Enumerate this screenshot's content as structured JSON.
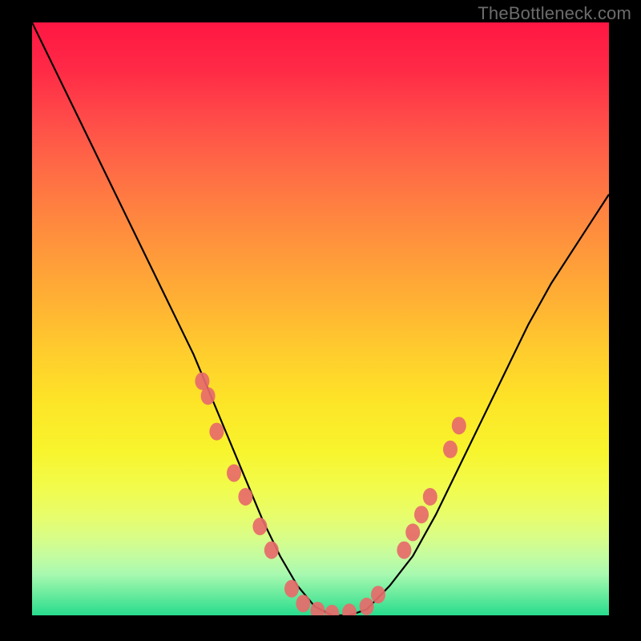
{
  "watermark": "TheBottleneck.com",
  "chart_data": {
    "type": "line",
    "title": "",
    "xlabel": "",
    "ylabel": "",
    "xlim": [
      0,
      100
    ],
    "ylim": [
      0,
      100
    ],
    "series": [
      {
        "name": "curve",
        "x": [
          0,
          4,
          8,
          12,
          16,
          20,
          24,
          28,
          31,
          34,
          37,
          40,
          43,
          46,
          49,
          52,
          55,
          58,
          62,
          66,
          70,
          74,
          78,
          82,
          86,
          90,
          94,
          98,
          100
        ],
        "y": [
          100,
          92,
          84,
          76,
          68,
          60,
          52,
          44,
          37,
          30,
          23,
          16,
          10,
          5,
          1.5,
          0,
          0,
          1,
          5,
          10,
          17,
          25,
          33,
          41,
          49,
          56,
          62,
          68,
          71
        ]
      }
    ],
    "markers": [
      {
        "x": 29.5,
        "y": 39.5
      },
      {
        "x": 30.5,
        "y": 37.0
      },
      {
        "x": 32.0,
        "y": 31.0
      },
      {
        "x": 35.0,
        "y": 24.0
      },
      {
        "x": 37.0,
        "y": 20.0
      },
      {
        "x": 39.5,
        "y": 15.0
      },
      {
        "x": 41.5,
        "y": 11.0
      },
      {
        "x": 45.0,
        "y": 4.5
      },
      {
        "x": 47.0,
        "y": 2.0
      },
      {
        "x": 49.5,
        "y": 0.8
      },
      {
        "x": 52.0,
        "y": 0.3
      },
      {
        "x": 55.0,
        "y": 0.5
      },
      {
        "x": 58.0,
        "y": 1.5
      },
      {
        "x": 60.0,
        "y": 3.5
      },
      {
        "x": 64.5,
        "y": 11.0
      },
      {
        "x": 66.0,
        "y": 14.0
      },
      {
        "x": 67.5,
        "y": 17.0
      },
      {
        "x": 69.0,
        "y": 20.0
      },
      {
        "x": 72.5,
        "y": 28.0
      },
      {
        "x": 74.0,
        "y": 32.0
      }
    ],
    "marker_color": "#e76a6a",
    "curve_color": "#000000",
    "background_gradient": [
      "#ff1643",
      "#28dc8d"
    ]
  }
}
